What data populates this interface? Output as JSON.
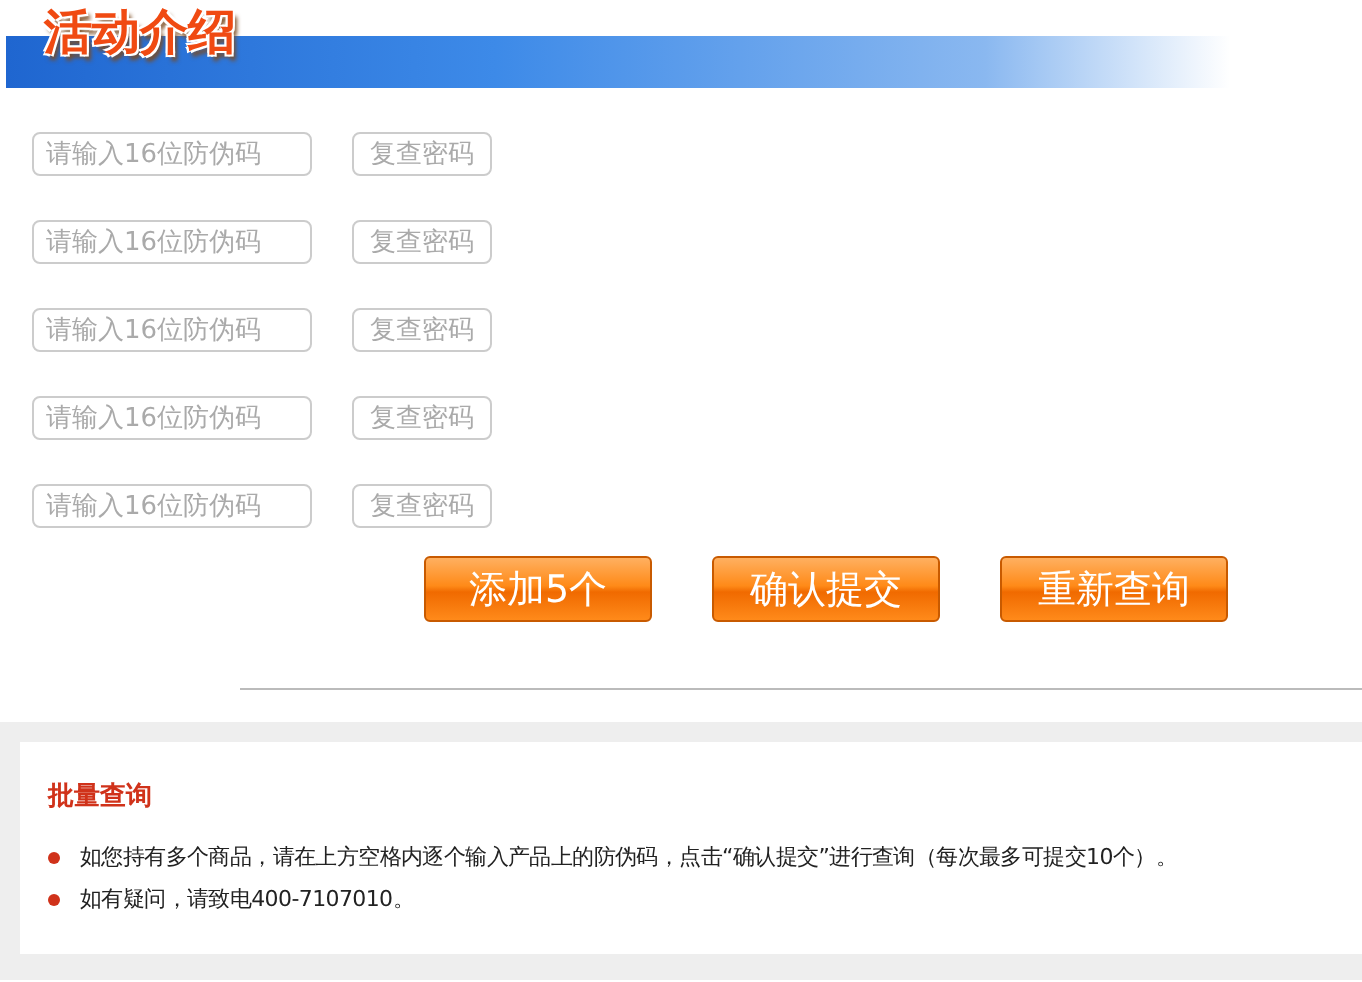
{
  "header": {
    "title": "活动介绍"
  },
  "code_rows": [
    {
      "placeholder": "请输入16位防伪码",
      "button": "复查密码"
    },
    {
      "placeholder": "请输入16位防伪码",
      "button": "复查密码"
    },
    {
      "placeholder": "请输入16位防伪码",
      "button": "复查密码"
    },
    {
      "placeholder": "请输入16位防伪码",
      "button": "复查密码"
    },
    {
      "placeholder": "请输入16位防伪码",
      "button": "复查密码"
    }
  ],
  "actions": [
    "添加5个",
    "确认提交",
    "重新查询"
  ],
  "notice": {
    "title": "批量查询",
    "items": [
      "如您持有多个商品，请在上方空格内逐个输入产品上的防伪码，点击“确认提交”进行查询（每次最多可提交10个）。",
      "如有疑问，请致电400-7107010。"
    ]
  }
}
